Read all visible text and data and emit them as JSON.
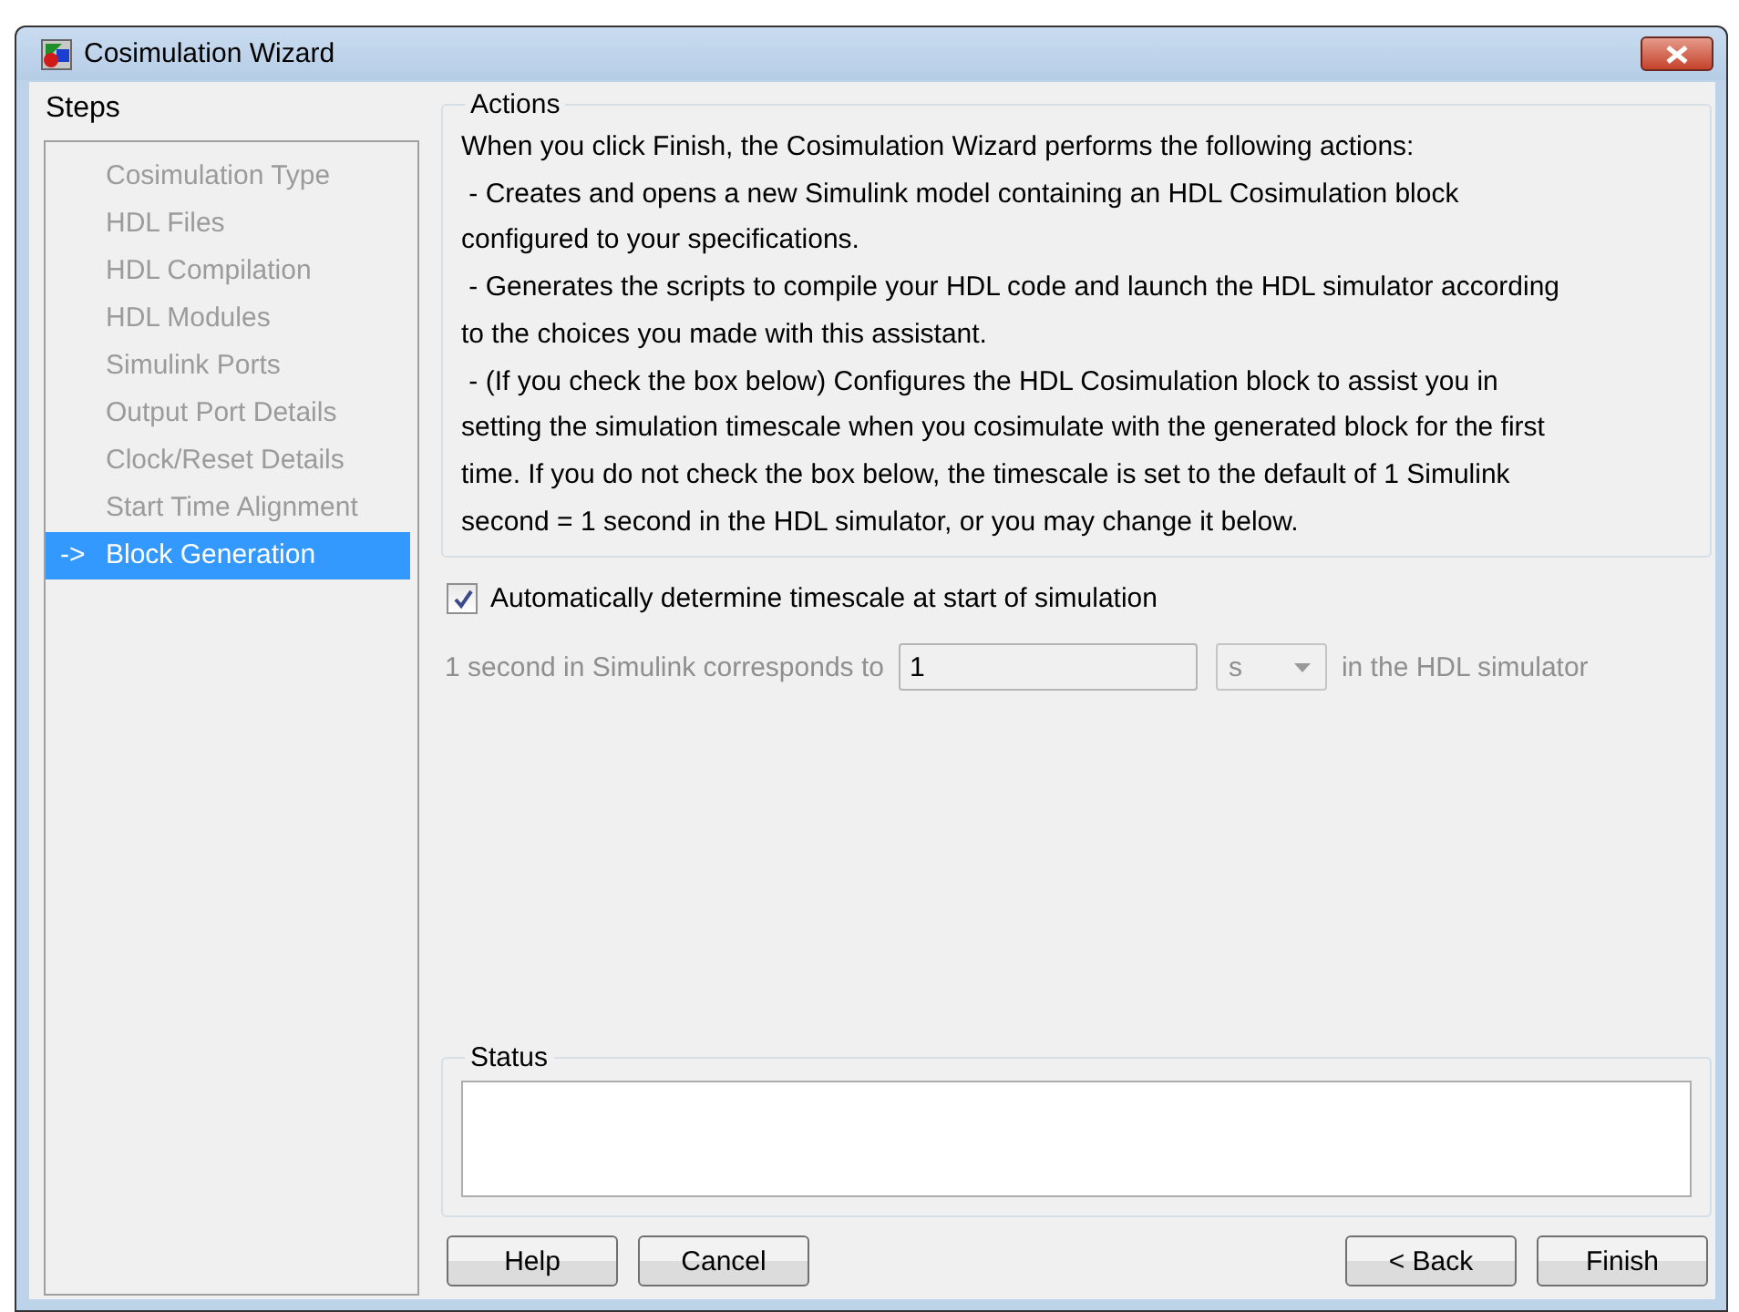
{
  "window": {
    "title": "Cosimulation Wizard"
  },
  "steps": {
    "title": "Steps",
    "items": [
      {
        "label": "Cosimulation Type",
        "selected": false,
        "disabled": true
      },
      {
        "label": "HDL Files",
        "selected": false,
        "disabled": true
      },
      {
        "label": "HDL Compilation",
        "selected": false,
        "disabled": true
      },
      {
        "label": "HDL Modules",
        "selected": false,
        "disabled": true
      },
      {
        "label": "Simulink Ports",
        "selected": false,
        "disabled": true
      },
      {
        "label": "Output Port Details",
        "selected": false,
        "disabled": true
      },
      {
        "label": "Clock/Reset Details",
        "selected": false,
        "disabled": true
      },
      {
        "label": "Start Time Alignment",
        "selected": false,
        "disabled": true
      },
      {
        "label": "Block Generation",
        "selected": true,
        "disabled": false,
        "marker": "->"
      }
    ]
  },
  "actions": {
    "title": "Actions",
    "lines": [
      "When you click Finish, the Cosimulation Wizard performs the following actions:",
      " - Creates and opens a new Simulink model containing an HDL Cosimulation block",
      "configured to your specifications.",
      " - Generates the scripts to compile your HDL code and launch the HDL simulator according",
      "to the choices you made with this assistant.",
      " - (If you check the box below) Configures the HDL Cosimulation block to assist you in",
      "setting the simulation timescale when you cosimulate with the generated block for the first",
      "time. If you do not check the box below, the timescale is set to the default of 1 Simulink",
      "second = 1 second in the HDL simulator, or you may change it below."
    ]
  },
  "auto_timescale": {
    "label": "Automatically determine timescale at start of simulation",
    "checked": true
  },
  "timescale": {
    "disabled": true,
    "label": "1 second in Simulink corresponds to",
    "value": "1",
    "unit": "s",
    "suffix": "in the HDL simulator"
  },
  "status": {
    "title": "Status"
  },
  "buttons": {
    "left": [
      "Help",
      "Cancel"
    ],
    "right": [
      "< Back",
      "Finish"
    ]
  }
}
